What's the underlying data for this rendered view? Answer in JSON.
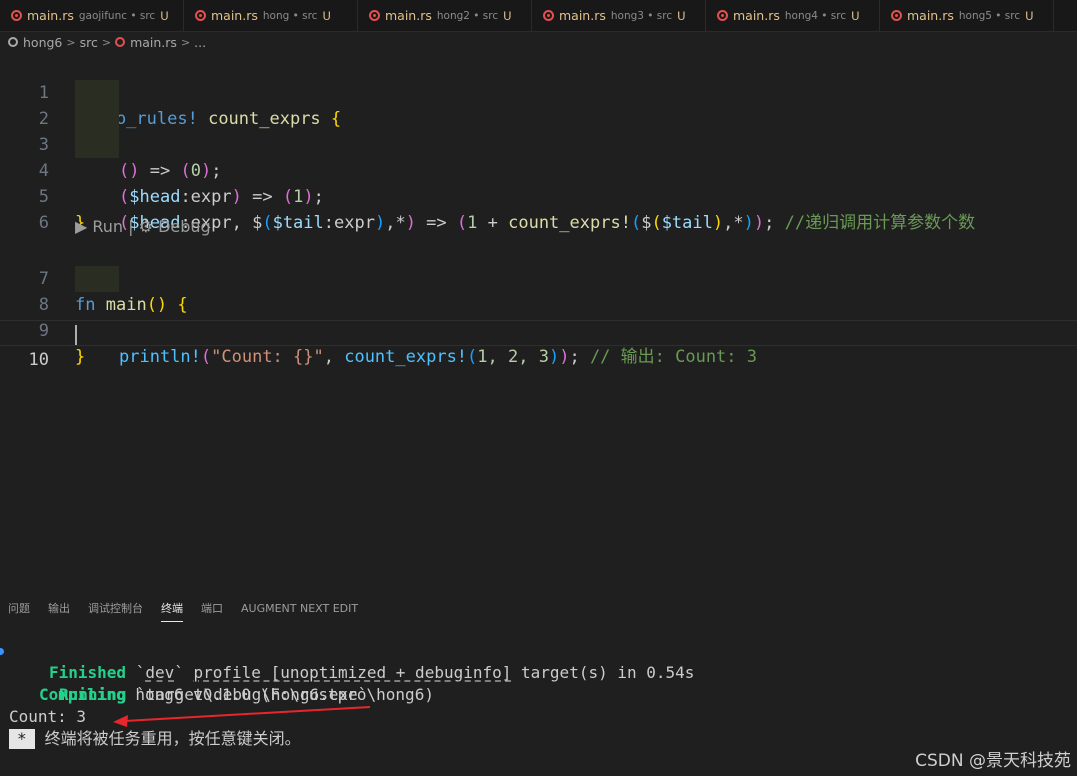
{
  "tabs": [
    {
      "name": "main.rs",
      "desc": "gaojifunc • src",
      "status": "U"
    },
    {
      "name": "main.rs",
      "desc": "hong • src",
      "status": "U"
    },
    {
      "name": "main.rs",
      "desc": "hong2 • src",
      "status": "U"
    },
    {
      "name": "main.rs",
      "desc": "hong3 • src",
      "status": "U"
    },
    {
      "name": "main.rs",
      "desc": "hong4 • src",
      "status": "U"
    },
    {
      "name": "main.rs",
      "desc": "hong5 • src",
      "status": "U"
    }
  ],
  "breadcrumb": {
    "project": "hong6",
    "folder": "src",
    "file": "main.rs",
    "more": "..."
  },
  "editor": {
    "line_numbers": [
      "1",
      "2",
      "3",
      "4",
      "5",
      "6",
      "7",
      "8",
      "9",
      "10"
    ],
    "codelens": "▶ Run | ⚙ Debug",
    "code": {
      "l1_kw": "macro_rules!",
      "l1_name": "count_exprs",
      "l2_a": "()",
      "l2_b": " => ",
      "l2_c": "(",
      "l2_d": "0",
      "l2_e": ");",
      "l3_var": "$head",
      "l3_rest": ":expr",
      "l3_num": "1",
      "l4_var1": "$head",
      "l4_t1": ":expr, $",
      "l4_var2": "$tail",
      "l4_t2": ":expr",
      "l4_t3": ",*",
      "l4_t4": " => ",
      "l4_num": "1",
      "l4_t5": " + ",
      "l4_mac": "count_exprs!",
      "l4_t6": "$",
      "l4_var3": "$tail",
      "l4_t7": ",*",
      "l4_t8": ";",
      "l4_cmt": " //递归调用计算参数个数",
      "l7_kw": "fn",
      "l7_fn": "main",
      "l8_mac": "println!",
      "l8_str": "\"Count: {}\"",
      "l8_mac2": "count_exprs!",
      "l8_nums": "1, 2, 3",
      "l8_cmt": " // 输出: Count: 3"
    }
  },
  "panel": {
    "tabs": [
      "问题",
      "输出",
      "调试控制台",
      "终端",
      "端口",
      "AUGMENT NEXT EDIT"
    ],
    "active_tab": "终端"
  },
  "terminal": {
    "l1_label": "Compiling",
    "l1_text": " hong6 v0.1.0 (F:\\rustpro\\hong6)",
    "l2_label": "Finished",
    "l2_a": " `",
    "l2_b": "dev",
    "l2_c": "` ",
    "l2_d": "profile [unoptimized + debuginfo]",
    "l2_e": " target(s) in 0.54s",
    "l3_label": "Running",
    "l3_text": " `target\\debug\\hong6.exe`",
    "l4_text": "Count: 3",
    "l5_star": "*",
    "l5_text": "终端将被任务重用，按任意键关闭。"
  },
  "watermark": "CSDN @景天科技苑",
  "colors": {
    "background": "#1f1f1f",
    "terminal_green": "#23d18b",
    "annotation_arrow": "#e8262b"
  }
}
